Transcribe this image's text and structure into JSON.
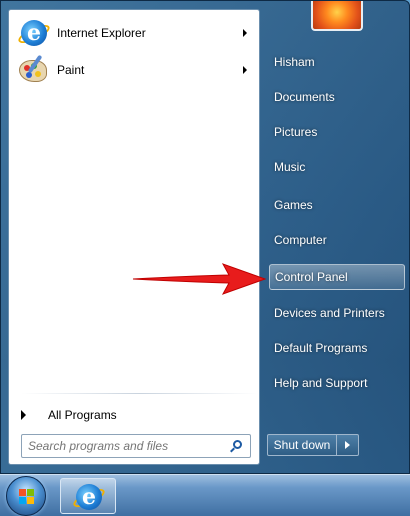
{
  "programs": [
    {
      "label": "Internet Explorer",
      "icon": "internet-explorer-icon",
      "has_submenu": true
    },
    {
      "label": "Paint",
      "icon": "paint-icon",
      "has_submenu": true
    }
  ],
  "all_programs_label": "All Programs",
  "search": {
    "placeholder": "Search programs and files",
    "value": ""
  },
  "right_panel": {
    "user": "Hisham",
    "items": [
      "Documents",
      "Pictures",
      "Music",
      "Games",
      "Computer",
      "Control Panel",
      "Devices and Printers",
      "Default Programs",
      "Help and Support"
    ],
    "highlighted_item": "Control Panel"
  },
  "shutdown_label": "Shut down",
  "annotation": {
    "type": "red-arrow",
    "points_to": "Control Panel",
    "color": "#e81c1c"
  },
  "taskbar": {
    "pinned": [
      "internet-explorer-icon"
    ]
  }
}
